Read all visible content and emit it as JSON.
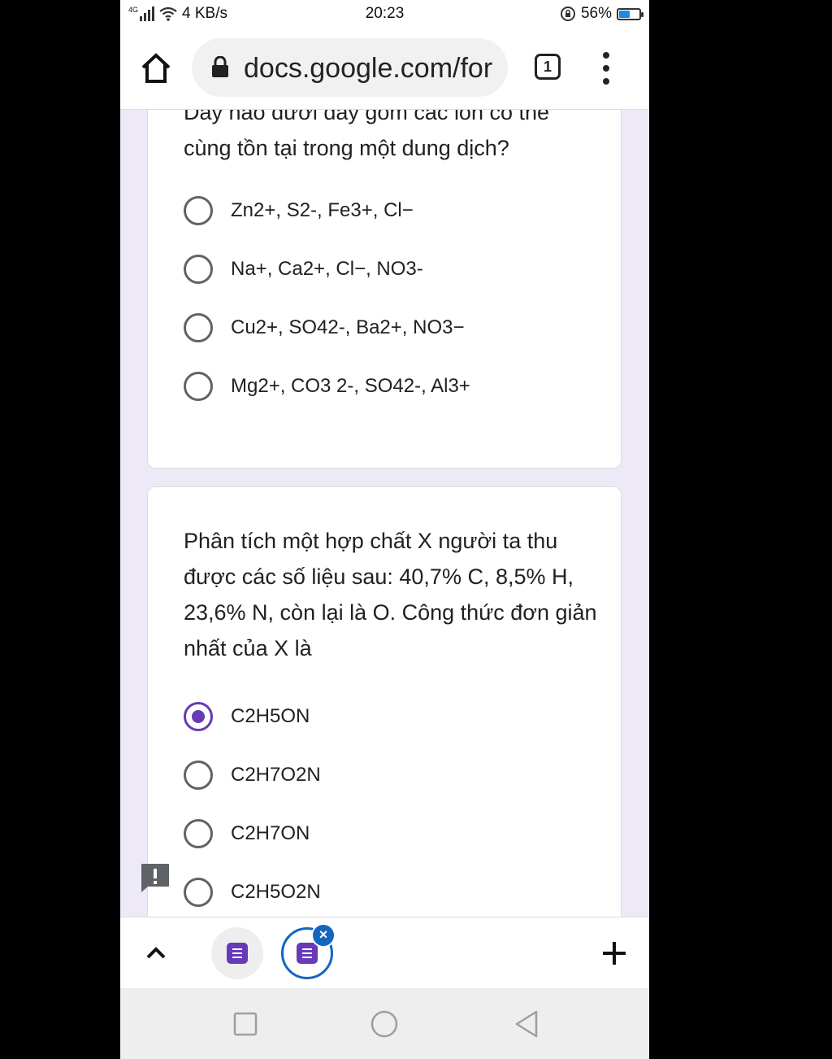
{
  "status_bar": {
    "network": "4G",
    "speed": "4 KB/s",
    "time": "20:23",
    "battery_percent": "56%",
    "battery_level": 0.56
  },
  "browser": {
    "url": "docs.google.com/for",
    "tab_count": "1"
  },
  "questions": [
    {
      "title": "Dãy nào dưới đây gồm các ion có thể cùng tồn tại trong một dung dịch?",
      "options": [
        {
          "label": "Zn2+, S2-, Fe3+, Cl−",
          "selected": false
        },
        {
          "label": "Na+, Ca2+, Cl−, NO3-",
          "selected": false
        },
        {
          "label": "Cu2+, SO42-, Ba2+, NO3−",
          "selected": false
        },
        {
          "label": "Mg2+, CO3 2-, SO42-, Al3+",
          "selected": false
        }
      ]
    },
    {
      "title": "Phân tích một hợp chất X người ta thu được các số liệu sau: 40,7% C, 8,5% H, 23,6% N, còn lại là O. Công thức đơn giản nhất của X là",
      "options": [
        {
          "label": "C2H5ON",
          "selected": true
        },
        {
          "label": "C2H7O2N",
          "selected": false
        },
        {
          "label": "C2H7ON",
          "selected": false
        },
        {
          "label": "C2H5O2N",
          "selected": false
        }
      ]
    }
  ],
  "colors": {
    "accent": "#673ab7",
    "page_background": "#ede9f7",
    "active_tab_ring": "#1565c0"
  },
  "icons": {
    "home": "home-icon",
    "lock": "lock-icon",
    "menu": "more-vert-icon",
    "report": "report-icon",
    "up": "chevron-up-icon",
    "new_tab": "plus-icon",
    "forms": "forms-icon",
    "close": "close-icon",
    "recents": "square-icon",
    "home_nav": "circle-icon",
    "back": "triangle-back-icon"
  }
}
